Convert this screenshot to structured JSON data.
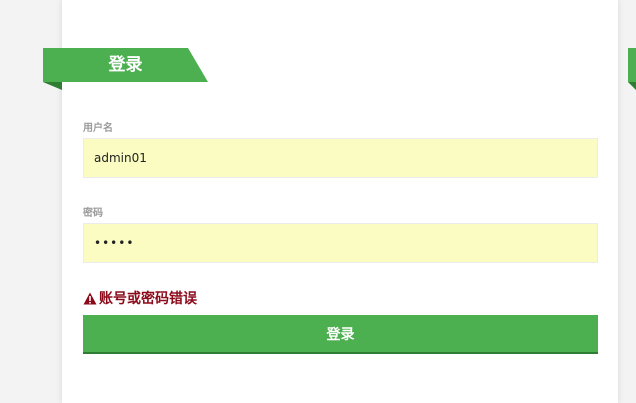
{
  "header": {
    "title": "登录"
  },
  "form": {
    "username": {
      "label": "用户名",
      "value": "admin01"
    },
    "password": {
      "label": "密码",
      "value": "•••••"
    },
    "error_message": "账号或密码错误",
    "submit_label": "登录"
  },
  "icons": {
    "warning": "warning-triangle-icon"
  },
  "colors": {
    "accent": "#4caf50",
    "accent_dark": "#2e7d32",
    "input_bg": "#fafcc2",
    "error": "#8b0a1a"
  }
}
